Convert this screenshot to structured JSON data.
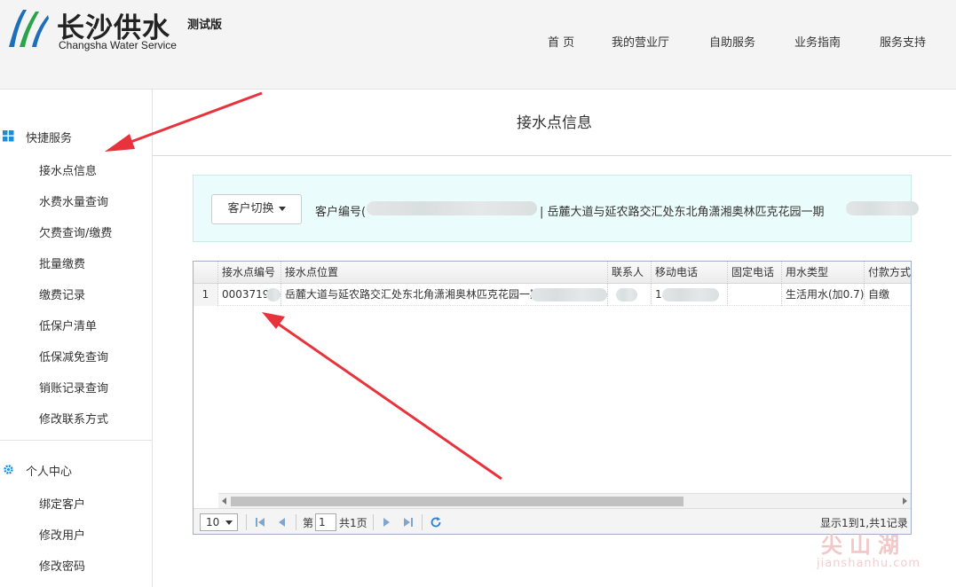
{
  "header": {
    "brand_cn": "长沙供水",
    "brand_en": "Changsha Water Service",
    "tag": "测试版",
    "nav": [
      "首 页",
      "我的营业厅",
      "自助服务",
      "业务指南",
      "服务支持"
    ]
  },
  "sidebar": {
    "section1": {
      "title": "快捷服务",
      "icon": "grid-icon",
      "items": [
        "接水点信息",
        "水费水量查询",
        "欠费查询/缴费",
        "批量缴费",
        "缴费记录",
        "低保户清单",
        "低保减免查询",
        "销账记录查询",
        "修改联系方式"
      ]
    },
    "section2": {
      "title": "个人中心",
      "icon": "gear-icon",
      "items": [
        "绑定客户",
        "修改用户",
        "修改密码"
      ]
    }
  },
  "main": {
    "title": "接水点信息",
    "switch_label": "客户切换",
    "customer_prefix": "客户编号(",
    "customer_address": "| 岳麓大道与延农路交汇处东北角潇湘奥林匹克花园一期"
  },
  "grid": {
    "columns": [
      "接水点编号",
      "接水点位置",
      "联系人",
      "移动电话",
      "固定电话",
      "用水类型",
      "付款方式"
    ],
    "rows": [
      {
        "num": "1",
        "cells": [
          "0003719",
          "岳麓大道与延农路交汇处东北角潇湘奥林匹克花园一期",
          "",
          "1",
          "",
          "生活用水(加0.7)",
          "自缴"
        ]
      }
    ],
    "pager": {
      "page_size": "10",
      "page_prefix": "第",
      "page_value": "1",
      "page_total": "共1页",
      "summary": "显示1到1,共1记录"
    }
  },
  "watermark": {
    "cn": "尖山湖",
    "en": "jianshanhu.com"
  },
  "colors": {
    "accent_red": "#e8323c",
    "logo_blue": "#1d6fb8",
    "logo_green": "#2aa44a",
    "panel_bg": "#eafcfb"
  }
}
